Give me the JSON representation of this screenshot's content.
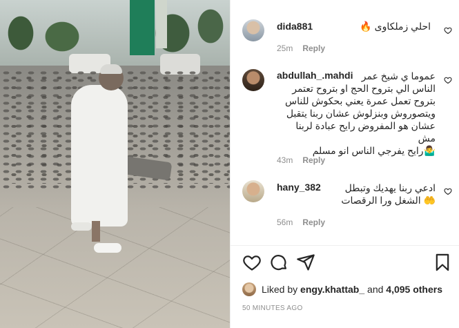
{
  "comments": [
    {
      "username": "dida881",
      "text": "احلي زملكاوى 🔥",
      "time": "25m",
      "reply_label": "Reply"
    },
    {
      "username": "abdullah_.mahdi",
      "text": "عموما ي شيخ عمر\nالناس الي بتروح الحج او بتروح تعتمر\nبتروح تعمل عمرة يعني بحكوش للناس\nويتصوروش وبنزلوش عشان ربنا يتقبل\nعشان هو المفروض رايح عبادة لربنا مش\n🤷‍♂️رايح يفرجي الناس انو مسلم",
      "time": "43m",
      "reply_label": "Reply"
    },
    {
      "username": "hany_382",
      "text": "ادعي ربنا يهديك وتبطل\n🤲 الشغل ورا الرقصات",
      "time": "56m",
      "reply_label": "Reply"
    }
  ],
  "likes": {
    "prefix": "Liked by",
    "user": "engy.khattab_",
    "middle": "and",
    "count": "4,095 others"
  },
  "timestamp": "50 MINUTES AGO",
  "icons": [
    "heart-icon",
    "comment-icon",
    "share-icon",
    "bookmark-icon"
  ]
}
